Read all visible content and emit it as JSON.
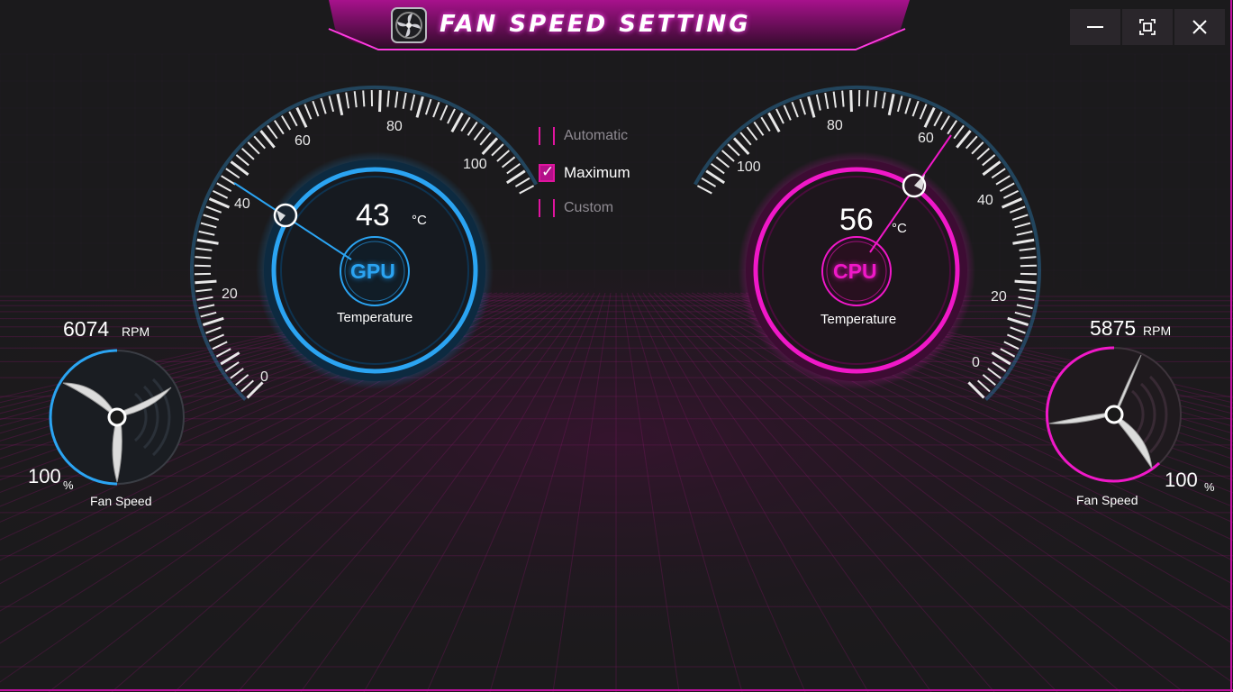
{
  "window": {
    "title": "FAN SPEED SETTING",
    "controls": {
      "minimize": "—",
      "maximize": "▢",
      "close": "X"
    }
  },
  "modes": [
    {
      "label": "Automatic",
      "checked": false
    },
    {
      "label": "Maximum",
      "checked": true
    },
    {
      "label": "Custom",
      "checked": false
    }
  ],
  "gpu": {
    "name": "GPU",
    "temperature": "43",
    "unit": "°C",
    "temp_label": "Temperature",
    "gauge_ticks": [
      "0",
      "20",
      "40",
      "60",
      "80",
      "100"
    ],
    "color": "#2ba4f2",
    "fan": {
      "rpm": "6074",
      "rpm_unit": "RPM",
      "percent": "100",
      "percent_unit": "%",
      "label": "Fan Speed"
    }
  },
  "cpu": {
    "name": "CPU",
    "temperature": "56",
    "unit": "°C",
    "temp_label": "Temperature",
    "gauge_ticks": [
      "0",
      "20",
      "40",
      "60",
      "80",
      "100"
    ],
    "color": "#f018c8",
    "fan": {
      "rpm": "5875",
      "rpm_unit": "RPM",
      "percent": "100",
      "percent_unit": "%",
      "label": "Fan Speed"
    }
  },
  "colors": {
    "accent": "#e0149f",
    "background": "#1b1a1c",
    "gpu": "#2ba4f2",
    "cpu": "#f018c8"
  }
}
